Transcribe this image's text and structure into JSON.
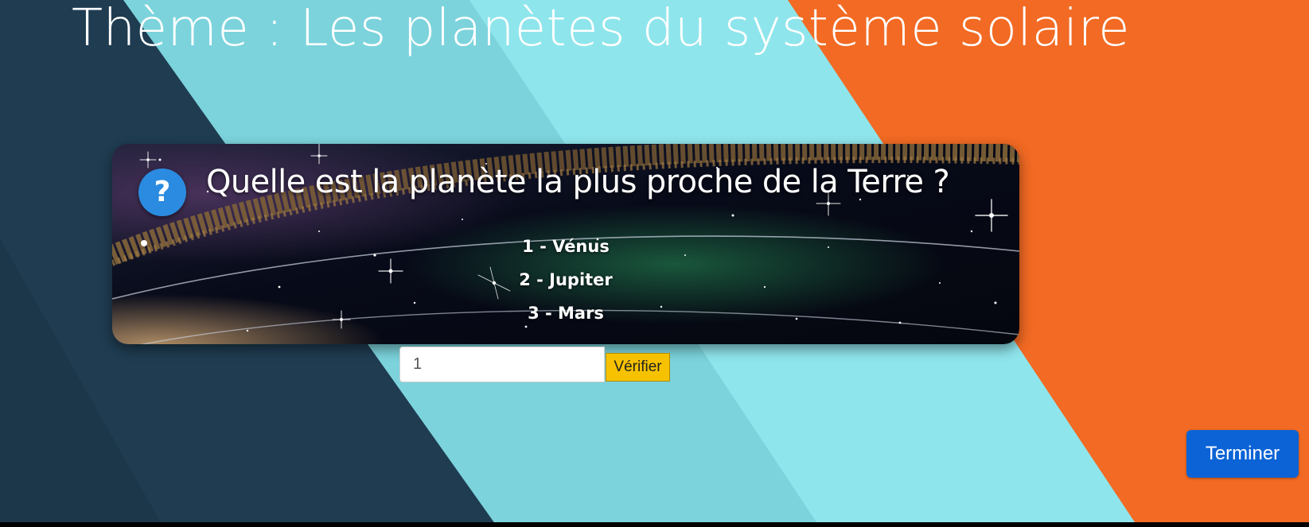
{
  "page": {
    "title": "Thème : Les planètes du système solaire"
  },
  "question": {
    "text": "Quelle est la planète la plus proche de la Terre ?",
    "icon": "help-question-icon",
    "icon_symbol": "?",
    "options": [
      "1 - Vénus",
      "2 - Jupiter",
      "3 - Mars"
    ]
  },
  "answer": {
    "value": "1"
  },
  "buttons": {
    "verify_label": "Vérifier",
    "finish_label": "Terminer"
  },
  "colors": {
    "dark_navy": "#1f3c51",
    "light_teal": "#7cd3dc",
    "cyan": "#8fe5ec",
    "orange": "#f26a23",
    "icon_blue": "#2a8be0",
    "verify_yellow": "#f6c200",
    "finish_blue": "#0b63d6"
  }
}
